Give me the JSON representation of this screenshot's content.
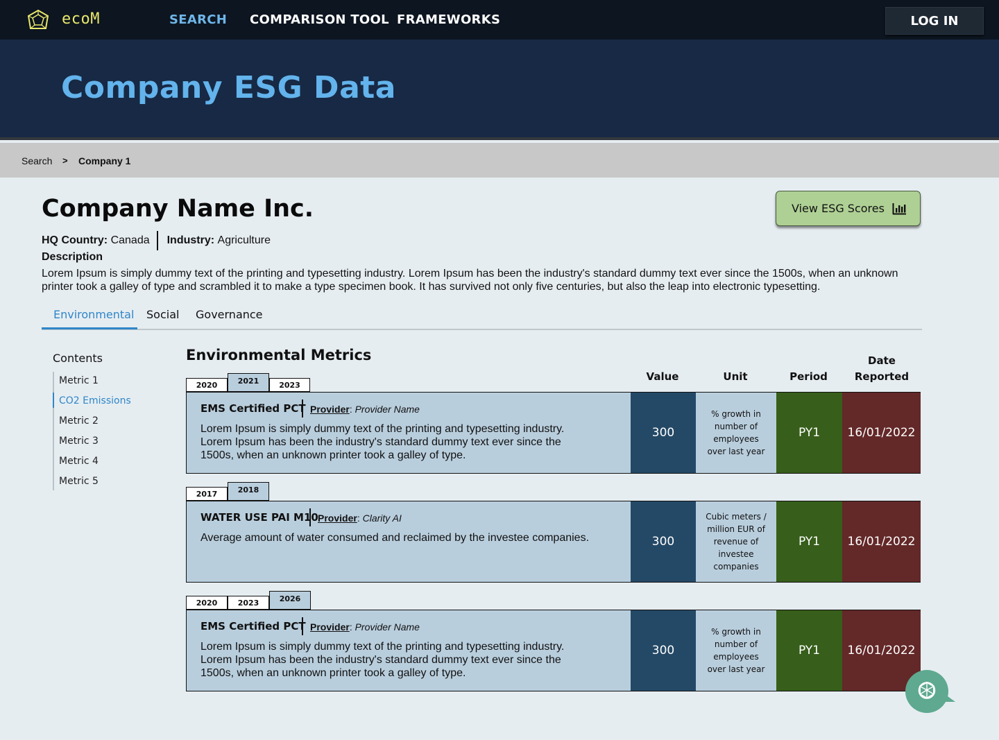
{
  "nav": {
    "logo_text": "ecoM",
    "links": [
      "SEARCH",
      "COMPARISON TOOL",
      "FRAMEWORKS"
    ],
    "active_link": "SEARCH",
    "login_label": "LOG IN"
  },
  "hero": {
    "title": "Company ESG Data"
  },
  "breadcrumb": {
    "items": [
      "Search",
      "Company 1"
    ],
    "separator": ">"
  },
  "company": {
    "name": "Company Name Inc.",
    "hq_label": "HQ Country:",
    "hq_value": "Canada",
    "industry_label": "Industry:",
    "industry_value": "Agriculture",
    "description_title": "Description",
    "description": "Lorem Ipsum is simply dummy text of the printing and typesetting industry. Lorem Ipsum has been the industry's standard dummy text ever since the 1500s, when an unknown printer took a galley of type and scrambled it to make a type specimen book. It has survived not only five centuries, but also the leap into electronic typesetting."
  },
  "esg_button": {
    "label": "View ESG Scores",
    "icon": "bar-chart-icon"
  },
  "tabs": [
    "Environmental",
    "Social",
    "Governance"
  ],
  "active_tab": "Environmental",
  "contents": {
    "title": "Contents",
    "items": [
      "Metric 1",
      "CO2 Emissions",
      "Metric 2",
      "Metric 3",
      "Metric 4",
      "Metric 5"
    ],
    "active": "CO2 Emissions"
  },
  "metrics": {
    "title": "Environmental Metrics",
    "columns": [
      "Value",
      "Unit",
      "Period",
      "Date Reported"
    ],
    "items": [
      {
        "years": [
          "2020",
          "2021",
          "2023"
        ],
        "active_year": "2021",
        "name": "EMS Certified PCT",
        "provider_label": "Provider",
        "provider": "Provider Name",
        "description": "Lorem Ipsum is simply dummy text of the printing and typesetting industry. Lorem Ipsum has been the industry's standard dummy text ever since the 1500s, when an unknown printer took a galley of type.",
        "value": "300",
        "unit": "% growth in number of employees over last year",
        "period": "PY1",
        "date": "16/01/2022"
      },
      {
        "years": [
          "2017",
          "2018"
        ],
        "active_year": "2018",
        "name": "WATER USE PAI M10",
        "provider_label": "Provider",
        "provider": "Clarity AI",
        "description": "Average amount of water consumed and reclaimed by the investee companies.",
        "value": "300",
        "unit": "Cubic meters / million EUR of revenue of investee companies",
        "period": "PY1",
        "date": "16/01/2022"
      },
      {
        "years": [
          "2020",
          "2023",
          "2026"
        ],
        "active_year": "2026",
        "name": "EMS Certified PCT",
        "provider_label": "Provider",
        "provider": "Provider Name",
        "description": "Lorem Ipsum is simply dummy text of the printing and typesetting industry. Lorem Ipsum has been the industry's standard dummy text ever since the 1500s, when an unknown printer took a galley of type.",
        "value": "300",
        "unit": "% growth in number of employees over last year",
        "period": "PY1",
        "date": "16/01/2022"
      }
    ]
  },
  "chat": {
    "icon": "chatbot-icon"
  },
  "colors": {
    "nav_bg": "#0d1520",
    "hero_bg": "#172944",
    "accent_blue": "#2f86c8",
    "value_bg": "#244966",
    "period_bg": "#375e1a",
    "date_bg": "#632828",
    "card_bg": "#b9cedd",
    "esg_button_bg": "#aed094"
  }
}
